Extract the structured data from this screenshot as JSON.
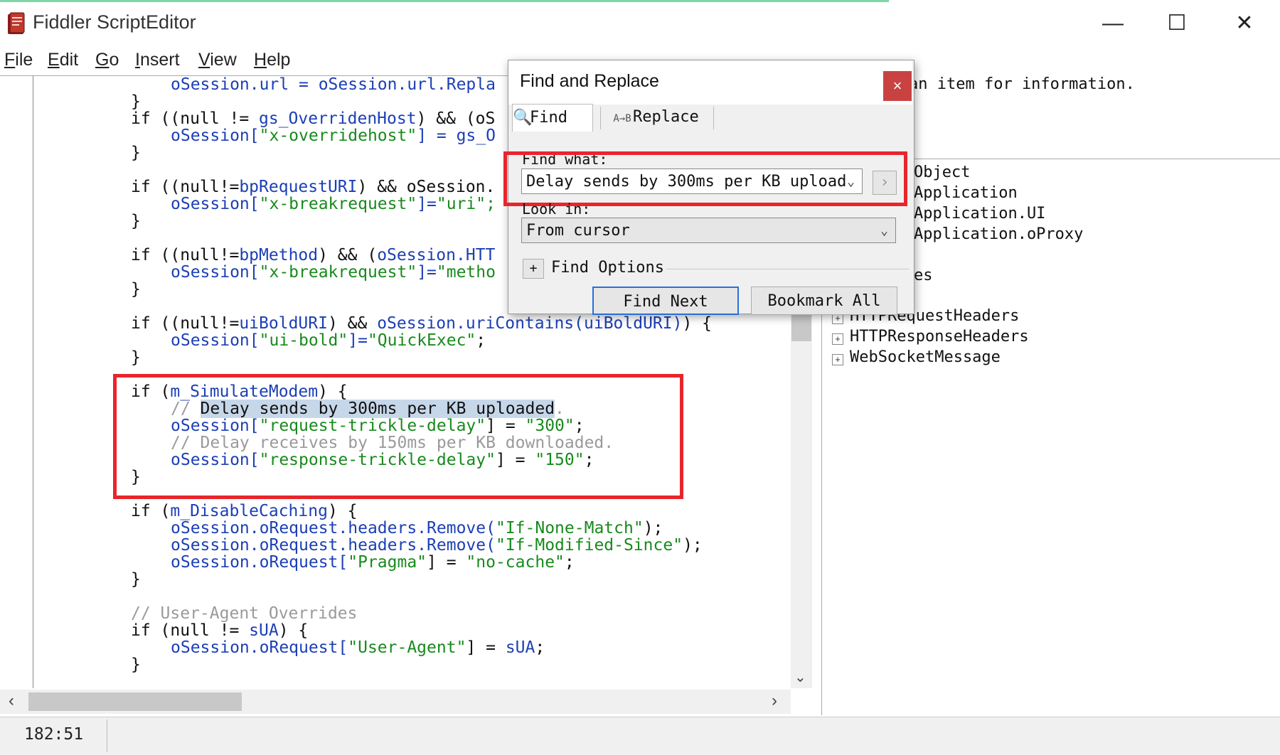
{
  "window": {
    "title": "Fiddler ScriptEditor",
    "minimize": "—",
    "maximize": "☐",
    "close": "✕"
  },
  "menu": [
    {
      "key": "F",
      "rest": "ile"
    },
    {
      "key": "E",
      "rest": "dit"
    },
    {
      "key": "G",
      "rest": "o"
    },
    {
      "key": "I",
      "rest": "nsert"
    },
    {
      "key": "V",
      "rest": "iew"
    },
    {
      "key": "H",
      "rest": "elp"
    }
  ],
  "code": {
    "l1": "oSession.url = oSession.url.Repla",
    "l2": "}",
    "l3a": "if ((null != ",
    "l3b": "gs_OverridenHost",
    "l3c": ") && (oS",
    "l4a": "oSession[",
    "l4b": "\"x-overridehost\"",
    "l4c": "] = gs_O",
    "l5": "}",
    "l6a": "if ((null!=",
    "l6b": "bpRequestURI",
    "l6c": ") && oSession.",
    "l7a": "oSession[",
    "l7b": "\"x-breakrequest\"",
    "l7c": "]=",
    "l7d": "\"uri\";",
    "l8": "}",
    "l9a": "if ((null!=",
    "l9b": "bpMethod",
    "l9c": ") && (",
    "l9d": "oSession.HTT",
    "l10a": "oSession[",
    "l10b": "\"x-breakrequest\"",
    "l10c": "]=",
    "l10d": "\"metho",
    "l11": "}",
    "l12a": "if ((null!=",
    "l12b": "uiBoldURI",
    "l12c": ") && ",
    "l12d": "oSession.uriContains(uiBoldURI)",
    "l12e": ") {",
    "l13a": "oSession[",
    "l13b": "\"ui-bold\"",
    "l13c": "]=",
    "l13d": "\"QuickExec\"",
    "l13e": ";",
    "l14": "}",
    "l15a": "if (",
    "l15b": "m_SimulateModem",
    "l15c": ") {",
    "l16a": "// ",
    "l16b": "Delay sends by 300ms per KB uploaded",
    "l16c": ".",
    "l17a": "oSession[",
    "l17b": "\"request-trickle-delay\"",
    "l17c": "] = ",
    "l17d": "\"300\"",
    "l17e": ";",
    "l18": "// Delay receives by 150ms per KB downloaded.",
    "l19a": "oSession[",
    "l19b": "\"response-trickle-delay\"",
    "l19c": "] = ",
    "l19d": "\"150\"",
    "l19e": ";",
    "l20": "}",
    "l21a": "if (",
    "l21b": "m_DisableCaching",
    "l21c": ") {",
    "l22a": "oSession.oRequest.headers.Remove(",
    "l22b": "\"If-None-Match\"",
    "l22c": ");",
    "l23a": "oSession.oRequest.headers.Remove(",
    "l23b": "\"If-Modified-Since\"",
    "l23c": ");",
    "l24a": "oSession.oRequest[",
    "l24b": "\"Pragma\"",
    "l24c": "] = ",
    "l24d": "\"no-cache\"",
    "l24e": ";",
    "l25": "}",
    "l26": "// User-Agent Overrides",
    "l27a": "if (null != ",
    "l27b": "sUA",
    "l27c": ") {",
    "l28a": "oSession.oRequest[",
    "l28b": "\"User-Agent\"",
    "l28c": "] = ",
    "l28d": "sUA",
    "l28e": ";",
    "l29": "}"
  },
  "right_panel": {
    "info": "an item for information.",
    "tree": [
      "Object",
      "Application",
      "Application.UI",
      "Application.oProxy",
      "es",
      "HTTPRequestHeaders",
      "HTTPResponseHeaders",
      "WebSocketMessage"
    ]
  },
  "status": {
    "position": "182:51"
  },
  "dialog": {
    "title": "Find and Replace",
    "close": "×",
    "tab_find": "Find",
    "tab_replace": "Replace",
    "find_what_label": "Find what:",
    "find_what_value": "Delay sends by 300ms per KB upload",
    "look_in_label": "Look in:",
    "look_in_value": "From cursor",
    "options_toggle": "+",
    "options_label": "Find Options",
    "find_next": "Find Next",
    "bookmark_all": "Bookmark All"
  },
  "colors": {
    "accent_red": "#e8252b",
    "close_red": "#c94242",
    "keyword_blue": "#1c3fb5",
    "string_green": "#188a1c",
    "comment_gray": "#9a9a9a"
  }
}
